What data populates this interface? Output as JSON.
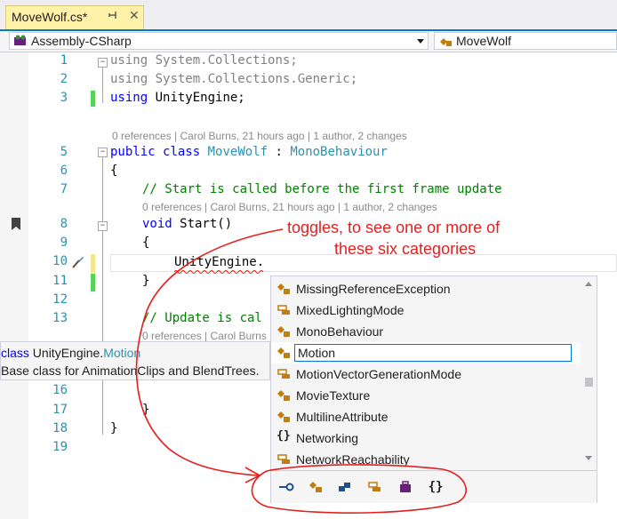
{
  "tab": {
    "title": "MoveWolf.cs*",
    "pin": "⊣",
    "close": "✕"
  },
  "navbar": {
    "project": "Assembly-CSharp",
    "class": "MoveWolf"
  },
  "editor": {
    "line_numbers": [
      "1",
      "2",
      "3",
      "5",
      "6",
      "7",
      "8",
      "9",
      "10",
      "11",
      "12",
      "13",
      "16",
      "17",
      "18",
      "19"
    ],
    "lines": {
      "l1a": "using",
      "l1b": " System.Collections;",
      "l2a": "using",
      "l2b": " System.Collections.Generic;",
      "l3a": "using",
      "l3b": " UnityEngine;",
      "lens1": "0 references | Carol Burns, 21 hours ago | 1 author, 2 changes",
      "l5a": "public",
      "l5b": " ",
      "l5c": "class",
      "l5d": " ",
      "l5e": "MoveWolf",
      "l5f": " : ",
      "l5g": "MonoBehaviour",
      "l6": "{",
      "l7": "// Start is called before the first frame update",
      "lens2": "0 references | Carol Burns, 21 hours ago | 1 author, 2 changes",
      "l8a": "void",
      "l8b": " Start()",
      "l9": "{",
      "l10": "UnityEngine.",
      "l11": "}",
      "l13": "// Update is cal",
      "lens3": "0 references | Carol Burns",
      "l17": "}",
      "l18": "}"
    }
  },
  "annotation": {
    "line1": "toggles, to see one or more of",
    "line2": "these six categories"
  },
  "tooltip": {
    "kw": "class",
    "ns": " UnityEngine.",
    "type": "Motion",
    "desc": "Base class for AnimationClips and BlendTrees."
  },
  "completion": {
    "items": [
      {
        "label": "MissingReferenceException",
        "icon": "class-icon"
      },
      {
        "label": "MixedLightingMode",
        "icon": "enum-icon"
      },
      {
        "label": "MonoBehaviour",
        "icon": "class-icon"
      },
      {
        "label": "Motion",
        "icon": "class-icon",
        "selected": true
      },
      {
        "label": "MotionVectorGenerationMode",
        "icon": "enum-icon"
      },
      {
        "label": "MovieTexture",
        "icon": "class-icon"
      },
      {
        "label": "MultilineAttribute",
        "icon": "class-icon"
      },
      {
        "label": "Networking",
        "icon": "namespace-icon"
      },
      {
        "label": "NetworkReachability",
        "icon": "enum-icon"
      }
    ],
    "filters": [
      "interface-filter-icon",
      "class-filter-icon",
      "struct-filter-icon",
      "enum-filter-icon",
      "delegate-filter-icon",
      "namespace-filter-icon"
    ]
  },
  "colors": {
    "accent": "#007acc",
    "annotation": "#e32020",
    "keyword": "#0000ff",
    "type": "#2b91af",
    "comment": "#008000"
  }
}
